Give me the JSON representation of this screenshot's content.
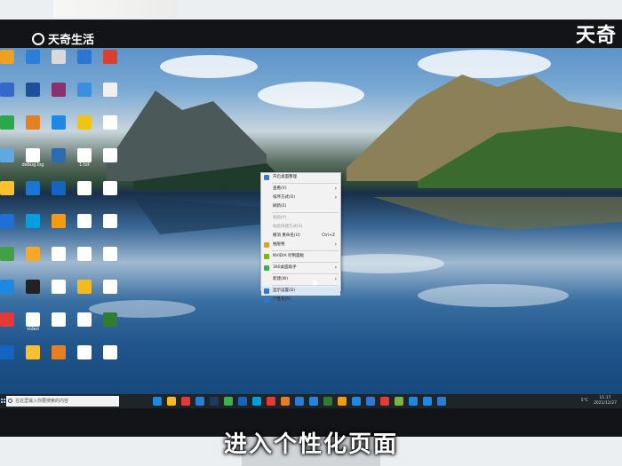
{
  "watermark": {
    "left": "天奇生活",
    "right": "天奇"
  },
  "desktop_icons": [
    {
      "label": "",
      "color": "#f0a020"
    },
    {
      "label": "",
      "color": "#2c7fd8"
    },
    {
      "label": "",
      "color": "#d9d9d9"
    },
    {
      "label": "",
      "color": "#2a76d0"
    },
    {
      "label": "",
      "color": "#d84030"
    },
    {
      "label": "",
      "color": "#3468c9"
    },
    {
      "label": "",
      "color": "#1d4f9a"
    },
    {
      "label": "",
      "color": "#8c2f6f"
    },
    {
      "label": "",
      "color": "#3b8fe0"
    },
    {
      "label": "",
      "color": "#f0f0f0"
    },
    {
      "label": "",
      "color": "#2aa84a"
    },
    {
      "label": "",
      "color": "#e67e22"
    },
    {
      "label": "",
      "color": "#1e88e5"
    },
    {
      "label": "",
      "color": "#f1c40f"
    },
    {
      "label": "",
      "color": "#ffffff"
    },
    {
      "label": "",
      "color": "#5fa8e0"
    },
    {
      "label": "debug.log",
      "color": "#ffffff"
    },
    {
      "label": "",
      "color": "#2b6cb0"
    },
    {
      "label": "1.txt",
      "color": "#ffffff"
    },
    {
      "label": "",
      "color": "#ffffff"
    },
    {
      "label": "",
      "color": "#fbc02d"
    },
    {
      "label": "",
      "color": "#1976d2"
    },
    {
      "label": "",
      "color": "#1565c0"
    },
    {
      "label": "",
      "color": "#ffffff"
    },
    {
      "label": "",
      "color": "#ffffff"
    },
    {
      "label": "",
      "color": "#1e6fd8"
    },
    {
      "label": "",
      "color": "#00a0e0"
    },
    {
      "label": "",
      "color": "#f39c12"
    },
    {
      "label": "",
      "color": "#ffffff"
    },
    {
      "label": "",
      "color": "#ffffff"
    },
    {
      "label": "",
      "color": "#43a047"
    },
    {
      "label": "",
      "color": "#f9a825"
    },
    {
      "label": "",
      "color": "#ffffff"
    },
    {
      "label": "",
      "color": "#ffffff"
    },
    {
      "label": "",
      "color": "#ffffff"
    },
    {
      "label": "",
      "color": "#1e88e5"
    },
    {
      "label": "",
      "color": "#222222"
    },
    {
      "label": "",
      "color": "#ffffff"
    },
    {
      "label": "",
      "color": "#f5b921"
    },
    {
      "label": "",
      "color": "#ffffff"
    },
    {
      "label": "",
      "color": "#e53935"
    },
    {
      "label": "video",
      "color": "#ffffff"
    },
    {
      "label": "",
      "color": "#ffffff"
    },
    {
      "label": "",
      "color": "#ffffff"
    },
    {
      "label": "",
      "color": "#2e7d32"
    },
    {
      "label": "",
      "color": "#1565c0"
    },
    {
      "label": "",
      "color": "#fbc02d"
    },
    {
      "label": "",
      "color": "#e67e22"
    },
    {
      "label": "",
      "color": "#ffffff"
    },
    {
      "label": "",
      "color": "#ffffff"
    }
  ],
  "context_menu": {
    "items": [
      {
        "label": "开启桌面整理",
        "icon": "#3a7bd5",
        "arrow": false,
        "disabled": false
      },
      {
        "sep": true
      },
      {
        "label": "查看(V)",
        "arrow": true,
        "disabled": false
      },
      {
        "label": "排序方式(O)",
        "arrow": true,
        "disabled": false
      },
      {
        "label": "刷新(E)",
        "arrow": false,
        "disabled": false
      },
      {
        "sep": true
      },
      {
        "label": "粘贴(P)",
        "arrow": false,
        "disabled": true
      },
      {
        "label": "粘贴快捷方式(S)",
        "arrow": false,
        "disabled": true
      },
      {
        "label": "撤消 重命名(U)",
        "key": "Ctrl+Z",
        "arrow": false,
        "disabled": false
      },
      {
        "label": "抽屉格",
        "icon": "#e0a020",
        "arrow": true,
        "disabled": false
      },
      {
        "sep": true
      },
      {
        "label": "NVIDIA 控制面板",
        "icon": "#76b900",
        "arrow": false,
        "disabled": false
      },
      {
        "sep": true
      },
      {
        "label": "360桌面助手",
        "icon": "#3bb34a",
        "arrow": true,
        "disabled": false
      },
      {
        "sep": true
      },
      {
        "label": "新建(W)",
        "arrow": true,
        "disabled": false
      },
      {
        "sep": true
      },
      {
        "label": "显示设置(D)",
        "icon": "#2b79d0",
        "arrow": false,
        "disabled": false,
        "highlight": true
      },
      {
        "label": "个性化(R)",
        "icon": "#2b79d0",
        "arrow": false,
        "disabled": false
      }
    ]
  },
  "taskbar": {
    "search_placeholder": "在这里输入你要搜索的内容",
    "app_icons": [
      "#1e88e5",
      "#f5b921",
      "#e53935",
      "#2b7bd8",
      "#1e3a5f",
      "#3bb34a",
      "#1565c0",
      "#00a0e0",
      "#e53935",
      "#e67e22",
      "#2b7bd8",
      "#1e88e5",
      "#2e7d32",
      "#f39c12",
      "#1e88e5",
      "#2b7bd8",
      "#e53935",
      "#7cb342",
      "#1e88e5",
      "#1e88e5",
      "#2b7bd8"
    ],
    "weather": "5°C",
    "time": "11:17",
    "date": "2021/12/27"
  },
  "subtitle": "进入个性化页面",
  "colors": {
    "accent": "#2b79d0",
    "taskbar": "#1f2428"
  }
}
